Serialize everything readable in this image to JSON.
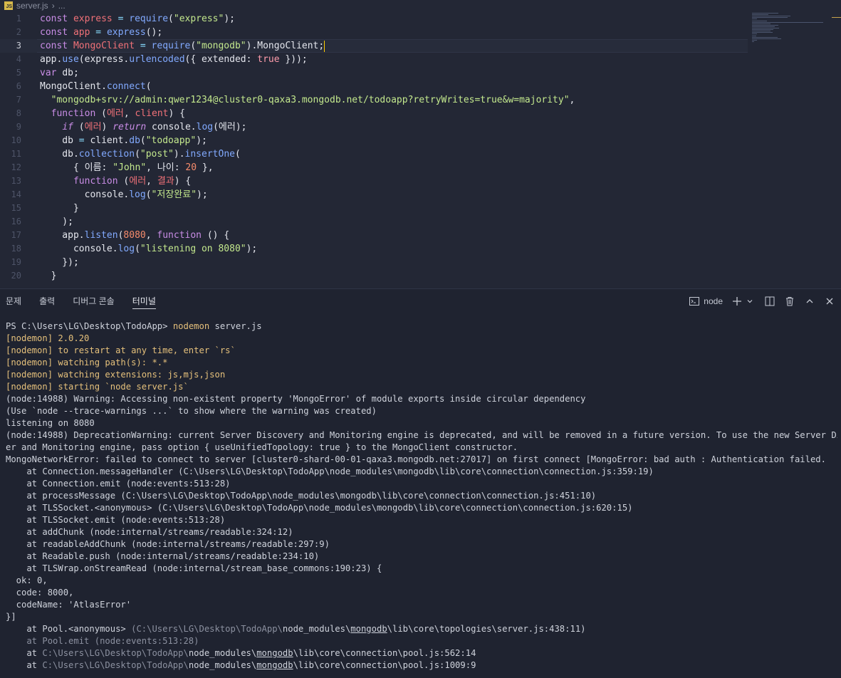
{
  "editor": {
    "breadcrumb": {
      "file": "server.js",
      "sep": "›",
      "rest": "..."
    },
    "lines": [
      {
        "n": "1",
        "seg": [
          [
            "kw",
            "const "
          ],
          [
            "var",
            "express"
          ],
          [
            "op",
            " = "
          ],
          [
            "fn",
            "require"
          ],
          [
            "",
            "("
          ],
          [
            "str",
            "\"express\""
          ],
          [
            "",
            ");"
          ]
        ]
      },
      {
        "n": "2",
        "seg": [
          [
            "kw",
            "const "
          ],
          [
            "var",
            "app"
          ],
          [
            "op",
            " = "
          ],
          [
            "fn",
            "express"
          ],
          [
            "",
            "();"
          ]
        ]
      },
      {
        "n": "3",
        "current": true,
        "seg": [
          [
            "kw",
            "const "
          ],
          [
            "var",
            "MongoClient"
          ],
          [
            "op",
            " = "
          ],
          [
            "fn",
            "require"
          ],
          [
            "",
            "("
          ],
          [
            "str",
            "\"mongodb\""
          ],
          [
            "",
            ")."
          ],
          [
            "",
            "MongoClient;"
          ]
        ]
      },
      {
        "n": "4",
        "seg": [
          [
            "",
            "app."
          ],
          [
            "fn",
            "use"
          ],
          [
            "",
            "(express."
          ],
          [
            "fn",
            "urlencoded"
          ],
          [
            "",
            "({ extended: "
          ],
          [
            "bool",
            "true"
          ],
          [
            "",
            " }));"
          ]
        ]
      },
      {
        "n": "5",
        "seg": [
          [
            "kw",
            "var "
          ],
          [
            "",
            "db;"
          ]
        ]
      },
      {
        "n": "6",
        "seg": [
          [
            "",
            "MongoClient."
          ],
          [
            "fn",
            "connect"
          ],
          [
            "",
            "("
          ]
        ]
      },
      {
        "n": "7",
        "seg": [
          [
            "",
            "  "
          ],
          [
            "str",
            "\"mongodb+srv://admin:qwer1234@cluster0-qaxa3.mongodb.net/todoapp?retryWrites=true&w=majority\""
          ],
          [
            "",
            ","
          ]
        ]
      },
      {
        "n": "8",
        "seg": [
          [
            "",
            "  "
          ],
          [
            "kw",
            "function "
          ],
          [
            "",
            "("
          ],
          [
            "var",
            "에러"
          ],
          [
            "",
            ", "
          ],
          [
            "var",
            "client"
          ],
          [
            "",
            ") {"
          ]
        ]
      },
      {
        "n": "9",
        "seg": [
          [
            "",
            "    "
          ],
          [
            "kw italic",
            "if "
          ],
          [
            "",
            "("
          ],
          [
            "var",
            "에러"
          ],
          [
            "",
            ") "
          ],
          [
            "kw italic",
            "return "
          ],
          [
            "",
            "console."
          ],
          [
            "fn",
            "log"
          ],
          [
            "",
            "(에러);"
          ]
        ]
      },
      {
        "n": "10",
        "seg": [
          [
            "",
            "    db "
          ],
          [
            "op",
            "= "
          ],
          [
            "",
            "client."
          ],
          [
            "fn",
            "db"
          ],
          [
            "",
            "("
          ],
          [
            "str",
            "\"todoapp\""
          ],
          [
            "",
            ");"
          ]
        ]
      },
      {
        "n": "11",
        "seg": [
          [
            "",
            "    db."
          ],
          [
            "fn",
            "collection"
          ],
          [
            "",
            "("
          ],
          [
            "str",
            "\"post\""
          ],
          [
            "",
            ")."
          ],
          [
            "fn",
            "insertOne"
          ],
          [
            "",
            "("
          ]
        ]
      },
      {
        "n": "12",
        "seg": [
          [
            "",
            "      { 이름: "
          ],
          [
            "str",
            "\"John\""
          ],
          [
            "",
            ", 나이: "
          ],
          [
            "num",
            "20"
          ],
          [
            "",
            " },"
          ]
        ]
      },
      {
        "n": "13",
        "seg": [
          [
            "",
            "      "
          ],
          [
            "kw",
            "function "
          ],
          [
            "",
            "("
          ],
          [
            "var",
            "에러"
          ],
          [
            "",
            ", "
          ],
          [
            "var",
            "결과"
          ],
          [
            "",
            ") {"
          ]
        ]
      },
      {
        "n": "14",
        "seg": [
          [
            "",
            "        console."
          ],
          [
            "fn",
            "log"
          ],
          [
            "",
            "("
          ],
          [
            "str",
            "\"저장완료\""
          ],
          [
            "",
            ");"
          ]
        ]
      },
      {
        "n": "15",
        "seg": [
          [
            "",
            "      }"
          ]
        ]
      },
      {
        "n": "16",
        "seg": [
          [
            "",
            "    );"
          ]
        ]
      },
      {
        "n": "17",
        "seg": [
          [
            "",
            "    app."
          ],
          [
            "fn",
            "listen"
          ],
          [
            "",
            "("
          ],
          [
            "num",
            "8080"
          ],
          [
            "",
            ", "
          ],
          [
            "kw",
            "function "
          ],
          [
            "",
            "() {"
          ]
        ]
      },
      {
        "n": "18",
        "seg": [
          [
            "",
            "      console."
          ],
          [
            "fn",
            "log"
          ],
          [
            "",
            "("
          ],
          [
            "str",
            "\"listening on 8080\""
          ],
          [
            "",
            ");"
          ]
        ]
      },
      {
        "n": "19",
        "seg": [
          [
            "",
            "    });"
          ]
        ]
      },
      {
        "n": "20",
        "seg": [
          [
            "",
            "  }"
          ]
        ]
      }
    ]
  },
  "panel": {
    "tabs": [
      "문제",
      "출력",
      "디버그 콘솔",
      "터미널"
    ],
    "active_tab": "터미널",
    "terminal_name": "node",
    "icons": [
      "terminal-icon",
      "plus-icon",
      "chevron-down-icon",
      "split-icon",
      "trash-icon",
      "chevron-up-icon",
      "close-icon"
    ]
  },
  "terminal": [
    [
      [
        "",
        "PS C:\\Users\\LG\\Desktop\\TodoApp> "
      ],
      [
        "y",
        "nodemon"
      ],
      [
        "",
        " server.js"
      ]
    ],
    [
      [
        "y",
        "[nodemon] 2.0.20"
      ]
    ],
    [
      [
        "y",
        "[nodemon] to restart at any time, enter `rs`"
      ]
    ],
    [
      [
        "y",
        "[nodemon] watching path(s): *.*"
      ]
    ],
    [
      [
        "y",
        "[nodemon] watching extensions: js,mjs,json"
      ]
    ],
    [
      [
        "y",
        "[nodemon] starting `node server.js`"
      ]
    ],
    [
      [
        "",
        "(node:14988) Warning: Accessing non-existent property 'MongoError' of module exports inside circular dependency"
      ]
    ],
    [
      [
        "",
        "(Use `node --trace-warnings ...` to show where the warning was created)"
      ]
    ],
    [
      [
        "",
        "listening on 8080"
      ]
    ],
    [
      [
        "",
        "(node:14988) DeprecationWarning: current Server Discovery and Monitoring engine is deprecated, and will be removed in a future version. To use the new Server Discov"
      ]
    ],
    [
      [
        "",
        "er and Monitoring engine, pass option { useUnifiedTopology: true } to the MongoClient constructor."
      ]
    ],
    [
      [
        "",
        "MongoNetworkError: failed to connect to server [cluster0-shard-00-01-qaxa3.mongodb.net:27017] on first connect [MongoError: bad auth : Authentication failed."
      ]
    ],
    [
      [
        "",
        "    at Connection.messageHandler (C:\\Users\\LG\\Desktop\\TodoApp\\node_modules\\mongodb\\lib\\core\\connection\\connection.js:359:19)"
      ]
    ],
    [
      [
        "",
        "    at Connection.emit (node:events:513:28)"
      ]
    ],
    [
      [
        "",
        "    at processMessage (C:\\Users\\LG\\Desktop\\TodoApp\\node_modules\\mongodb\\lib\\core\\connection\\connection.js:451:10)"
      ]
    ],
    [
      [
        "",
        "    at TLSSocket.<anonymous> (C:\\Users\\LG\\Desktop\\TodoApp\\node_modules\\mongodb\\lib\\core\\connection\\connection.js:620:15)"
      ]
    ],
    [
      [
        "",
        "    at TLSSocket.emit (node:events:513:28)"
      ]
    ],
    [
      [
        "",
        "    at addChunk (node:internal/streams/readable:324:12)"
      ]
    ],
    [
      [
        "",
        "    at readableAddChunk (node:internal/streams/readable:297:9)"
      ]
    ],
    [
      [
        "",
        "    at Readable.push (node:internal/streams/readable:234:10)"
      ]
    ],
    [
      [
        "",
        "    at TLSWrap.onStreamRead (node:internal/stream_base_commons:190:23) {"
      ]
    ],
    [
      [
        "",
        "  ok: 0,"
      ]
    ],
    [
      [
        "",
        "  code: 8000,"
      ]
    ],
    [
      [
        "",
        "  codeName: 'AtlasError'"
      ]
    ],
    [
      [
        "",
        "}]"
      ]
    ],
    [
      [
        "",
        "    at Pool.<anonymous> "
      ],
      [
        "dim",
        "(C:\\Users\\LG\\Desktop\\TodoApp\\"
      ],
      [
        "",
        "node_modules\\"
      ],
      [
        "u",
        "mongodb"
      ],
      [
        "",
        "\\lib\\core\\topologies\\server.js:438:11)"
      ]
    ],
    [
      [
        "dim",
        "    at Pool.emit (node:events:513:28)"
      ]
    ],
    [
      [
        "",
        "    at "
      ],
      [
        "dim",
        "C:\\Users\\LG\\Desktop\\TodoApp\\"
      ],
      [
        "",
        "node_modules\\"
      ],
      [
        "u",
        "mongodb"
      ],
      [
        "",
        "\\lib\\core\\connection\\pool.js:562:14"
      ]
    ],
    [
      [
        "",
        "    at "
      ],
      [
        "dim",
        "C:\\Users\\LG\\Desktop\\TodoApp\\"
      ],
      [
        "",
        "node_modules\\"
      ],
      [
        "u",
        "mongodb"
      ],
      [
        "",
        "\\lib\\core\\connection\\pool.js:1009:9"
      ]
    ]
  ]
}
